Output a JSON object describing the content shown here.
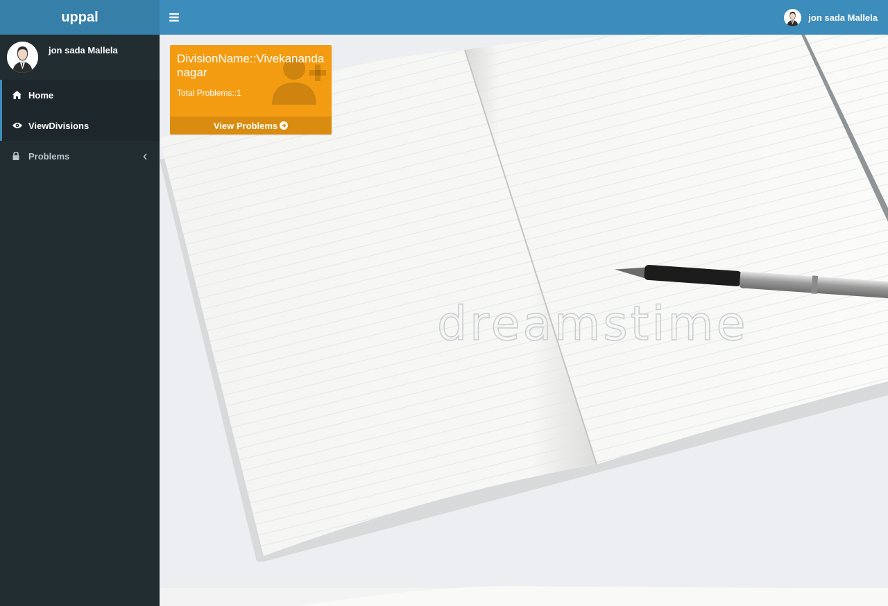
{
  "app": {
    "logo_text": "uppal"
  },
  "header": {
    "menu_toggle_icon": "bars-icon",
    "user_name": "jon sada Mallela",
    "user_avatar_icon": "user-avatar-icon"
  },
  "sidebar": {
    "user_name": "jon sada Mallela",
    "items": [
      {
        "label": "Home",
        "icon": "home-icon",
        "active": true
      },
      {
        "label": "ViewDivisions",
        "icon": "eye-icon",
        "active": true
      },
      {
        "label": "Problems",
        "icon": "lock-icon",
        "active": false,
        "has_submenu": true
      }
    ]
  },
  "content": {
    "background": "notebook-with-pen-photo",
    "watermark": "dreamstime"
  },
  "division_card": {
    "title": "DivisionName::Vivekananda nagar",
    "total_problems": "Total Problems::1",
    "footer_label": "View Problems",
    "icon": "user-plus-icon",
    "color": "#f39c12"
  },
  "colors": {
    "header": "#3c8dbc",
    "logo_bg": "#367fa9",
    "sidebar": "#222d32",
    "sidebar_active": "#1e282c"
  }
}
